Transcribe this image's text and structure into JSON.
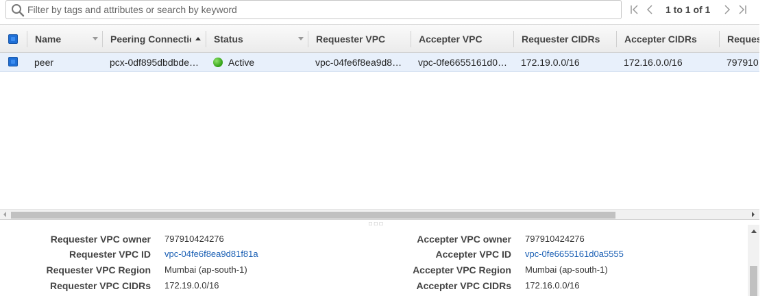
{
  "search": {
    "placeholder": "Filter by tags and attributes or search by keyword",
    "value": ""
  },
  "pager": {
    "text": "1 to 1 of 1"
  },
  "table": {
    "columns": [
      {
        "label": "Name",
        "sort": "none"
      },
      {
        "label": "Peering Connection",
        "sort": "ascending"
      },
      {
        "label": "Status",
        "sort": "none"
      },
      {
        "label": "Requester VPC"
      },
      {
        "label": "Accepter VPC"
      },
      {
        "label": "Requester CIDRs"
      },
      {
        "label": "Accepter CIDRs"
      },
      {
        "label": "Requester"
      }
    ],
    "rows": [
      {
        "selected": true,
        "name": "peer",
        "peering_connection": "pcx-0df895dbdbde…",
        "status": "Active",
        "status_color": "#3cb01b",
        "requester_vpc": "vpc-04fe6f8ea9d8…",
        "accepter_vpc": "vpc-0fe6655161d0…",
        "requester_cidrs": "172.19.0.0/16",
        "accepter_cidrs": "172.16.0.0/16",
        "requester_owner": "797910"
      }
    ]
  },
  "details": {
    "left": [
      {
        "label": "Requester VPC owner",
        "value": "797910424276",
        "link": false
      },
      {
        "label": "Requester VPC ID",
        "value": "vpc-04fe6f8ea9d81f81a",
        "link": true
      },
      {
        "label": "Requester VPC Region",
        "value": "Mumbai (ap-south-1)",
        "link": false
      },
      {
        "label": "Requester VPC CIDRs",
        "value": "172.19.0.0/16",
        "link": false
      }
    ],
    "right": [
      {
        "label": "Accepter VPC owner",
        "value": "797910424276",
        "link": false
      },
      {
        "label": "Accepter VPC ID",
        "value": "vpc-0fe6655161d0a5555",
        "link": true
      },
      {
        "label": "Accepter VPC Region",
        "value": "Mumbai (ap-south-1)",
        "link": false
      },
      {
        "label": "Accepter VPC CIDRs",
        "value": "172.16.0.0/16",
        "link": false
      }
    ]
  },
  "colors": {
    "accent": "#1f6fd6",
    "link": "#1a5fb4",
    "selected_row": "#e8f0fb"
  }
}
